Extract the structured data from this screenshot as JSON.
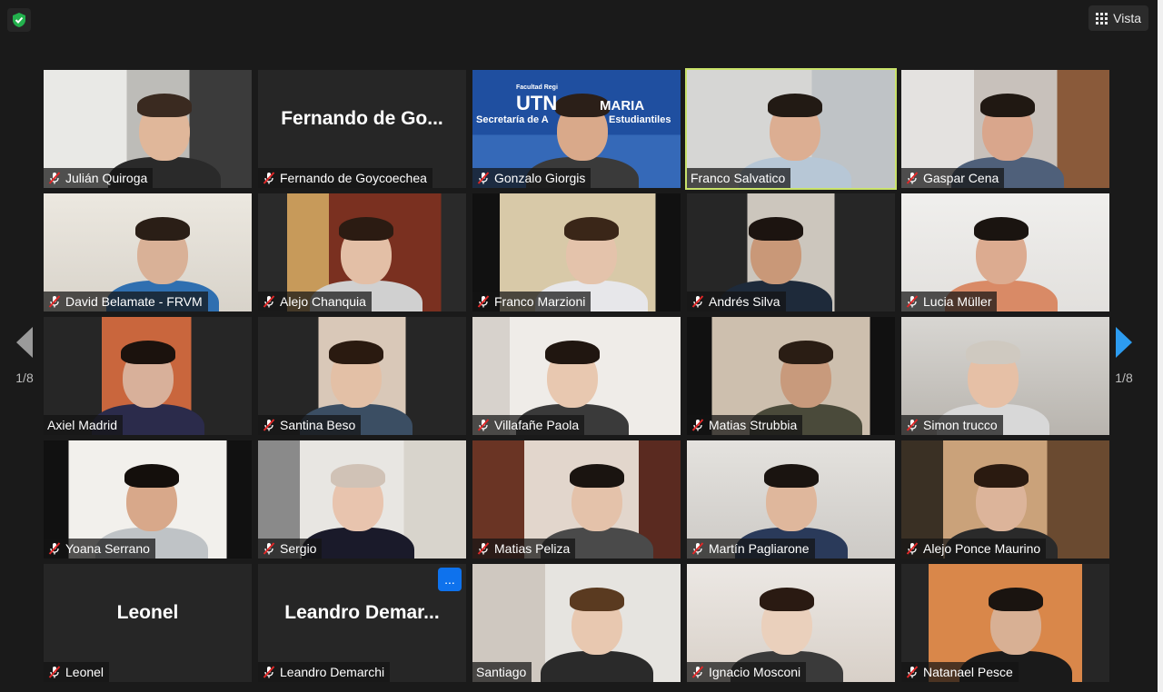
{
  "toolbar": {
    "view_label": "Vista",
    "security_icon": "shield-check-icon"
  },
  "pagination": {
    "left": "1/8",
    "right": "1/8"
  },
  "colors": {
    "accent_active": "#c9e26a",
    "muted_icon": "#e02828",
    "more_button": "#0e72ed",
    "arrow_right": "#2d9cf0"
  },
  "participants": [
    {
      "name": "Julián Quiroga",
      "video": true,
      "muted": true
    },
    {
      "name": "Fernando de Goycoechea",
      "video": false,
      "display_label": "Fernando de Go...",
      "muted": true
    },
    {
      "name": "Gonzalo Giorgis",
      "video": true,
      "muted": true,
      "backdrop_text": [
        "UTN",
        "MARIA",
        "Secretaría de A",
        "Estudiantiles",
        "Facultad Regi"
      ]
    },
    {
      "name": "Franco Salvatico",
      "video": true,
      "muted": false,
      "active_speaker": true
    },
    {
      "name": "Gaspar Cena",
      "video": true,
      "muted": true
    },
    {
      "name": "David Belamate - FRVM",
      "video": true,
      "muted": true
    },
    {
      "name": "Alejo Chanquia",
      "video": true,
      "muted": true
    },
    {
      "name": "Franco Marzioni",
      "video": true,
      "muted": true
    },
    {
      "name": "Andrés Silva",
      "video": true,
      "muted": true
    },
    {
      "name": "Lucia Müller",
      "video": true,
      "muted": true
    },
    {
      "name": "Axiel Madrid",
      "video": true,
      "muted": false
    },
    {
      "name": "Santina Beso",
      "video": true,
      "muted": true
    },
    {
      "name": "Villafañe Paola",
      "video": true,
      "muted": true
    },
    {
      "name": "Matias Strubbia",
      "video": true,
      "muted": true
    },
    {
      "name": "Simon trucco",
      "video": true,
      "muted": true
    },
    {
      "name": "Yoana Serrano",
      "video": true,
      "muted": true
    },
    {
      "name": "Sergio",
      "video": true,
      "muted": true
    },
    {
      "name": "Matias Peliza",
      "video": true,
      "muted": true
    },
    {
      "name": "Martín Pagliarone",
      "video": true,
      "muted": true
    },
    {
      "name": "Alejo Ponce Maurino",
      "video": true,
      "muted": true
    },
    {
      "name": "Leonel",
      "video": false,
      "display_label": "Leonel",
      "muted": true
    },
    {
      "name": "Leandro Demarchi",
      "video": false,
      "display_label": "Leandro Demar...",
      "muted": true,
      "more_button": "..."
    },
    {
      "name": "Santiago",
      "video": true,
      "muted": false
    },
    {
      "name": "Ignacio Mosconi",
      "video": true,
      "muted": true
    },
    {
      "name": "Natanael Pesce",
      "video": true,
      "muted": true
    }
  ]
}
